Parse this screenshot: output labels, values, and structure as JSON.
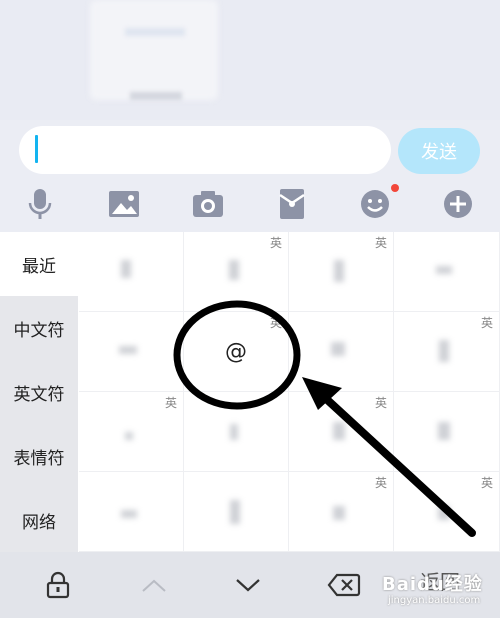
{
  "input": {
    "placeholder": ""
  },
  "send_label": "发送",
  "toolbar": [
    "mic-icon",
    "image-icon",
    "camera-icon",
    "red-packet-icon",
    "emoji-icon",
    "plus-icon"
  ],
  "categories": [
    "最近",
    "中文符",
    "英文符",
    "表情符",
    "网络"
  ],
  "active_category": 0,
  "grid": {
    "rows": [
      [
        {
          "tag": "",
          "sym": ""
        },
        {
          "tag": "英",
          "sym": ""
        },
        {
          "tag": "英",
          "sym": ""
        },
        {
          "tag": "",
          "sym": ""
        }
      ],
      [
        {
          "tag": "",
          "sym": ""
        },
        {
          "tag": "英",
          "sym": "@"
        },
        {
          "tag": "",
          "sym": ""
        },
        {
          "tag": "英",
          "sym": ""
        }
      ],
      [
        {
          "tag": "英",
          "sym": ""
        },
        {
          "tag": "",
          "sym": ""
        },
        {
          "tag": "英",
          "sym": ""
        },
        {
          "tag": "",
          "sym": ""
        }
      ],
      [
        {
          "tag": "",
          "sym": ""
        },
        {
          "tag": "",
          "sym": ""
        },
        {
          "tag": "英",
          "sym": ""
        },
        {
          "tag": "英",
          "sym": ""
        }
      ]
    ]
  },
  "bottom": {
    "return_label": "返回"
  },
  "watermark": {
    "text": "Baidu经验",
    "url": "jingyan.baidu.com"
  },
  "colors": {
    "accent": "#13b4f0",
    "send_bg": "#b4e6fb",
    "badge": "#f2473a"
  }
}
